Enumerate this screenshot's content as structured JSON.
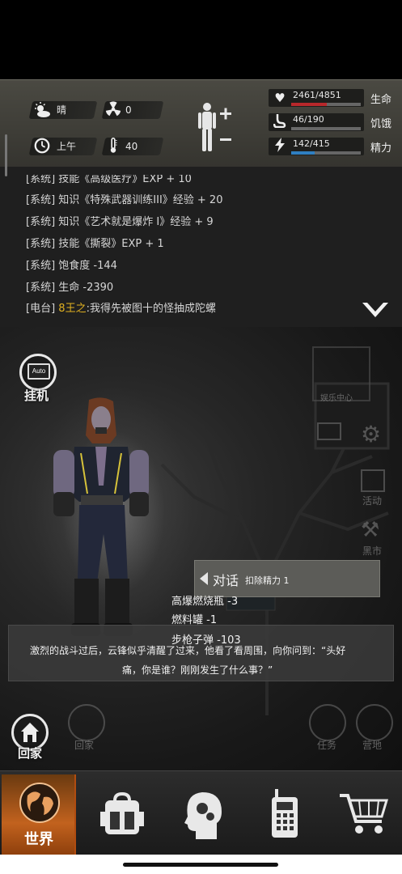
{
  "status": {
    "weather": "晴",
    "radiation": "0",
    "time_of_day": "上午",
    "temperature": "40"
  },
  "vitals": {
    "health": {
      "value": "2461/4851",
      "label": "生命",
      "fraction": 0.507,
      "color": "#b8282b"
    },
    "hunger": {
      "value": "46/190",
      "label": "饥饿",
      "fraction": 0.242,
      "color": "#6a6a6a"
    },
    "stamina": {
      "value": "142/415",
      "label": "精力",
      "fraction": 0.342,
      "color": "#2f7fc1"
    }
  },
  "log": [
    {
      "text": "[系统] 技能《高级医疗》EXP + 10"
    },
    {
      "text": "[系统] 知识《特殊武器训练III》经验 + 20"
    },
    {
      "text": "[系统] 知识《艺术就是爆炸 I》经验 + 9"
    },
    {
      "text": "[系统] 技能《撕裂》EXP + 1"
    },
    {
      "text": "[系统] 饱食度 -144"
    },
    {
      "text": "[系统] 生命 -2390"
    }
  ],
  "radio": {
    "prefix": "[电台]",
    "speaker": "8王之",
    "message": ":我得先被图十的怪抽成陀螺"
  },
  "scene": {
    "auto_button_text": "Auto",
    "auto_label": "挂机",
    "entertainment_label": "娱乐中心",
    "gift_label": "活动",
    "market_label": "黑市",
    "home_label": "回家",
    "home_faded": "回家",
    "task_label": "任务",
    "camp_label": "营地"
  },
  "dialog": {
    "label": "对话",
    "cost": "扣除精力 1"
  },
  "losses": [
    "高爆燃烧瓶 -3",
    "燃料罐 -1",
    "步枪子弹 -103"
  ],
  "narration": {
    "line1": "激烈的战斗过后，云锋似乎清醒了过来，他看了看周围，向你问到：“头好",
    "line2": "痛，你是谁？刚刚发生了什么事？”"
  },
  "nav": {
    "world": "世界",
    "items": [
      "backpack-icon",
      "skills-icon",
      "radio-icon",
      "shop-icon"
    ]
  },
  "colors": {
    "accent": "#c2621e"
  }
}
